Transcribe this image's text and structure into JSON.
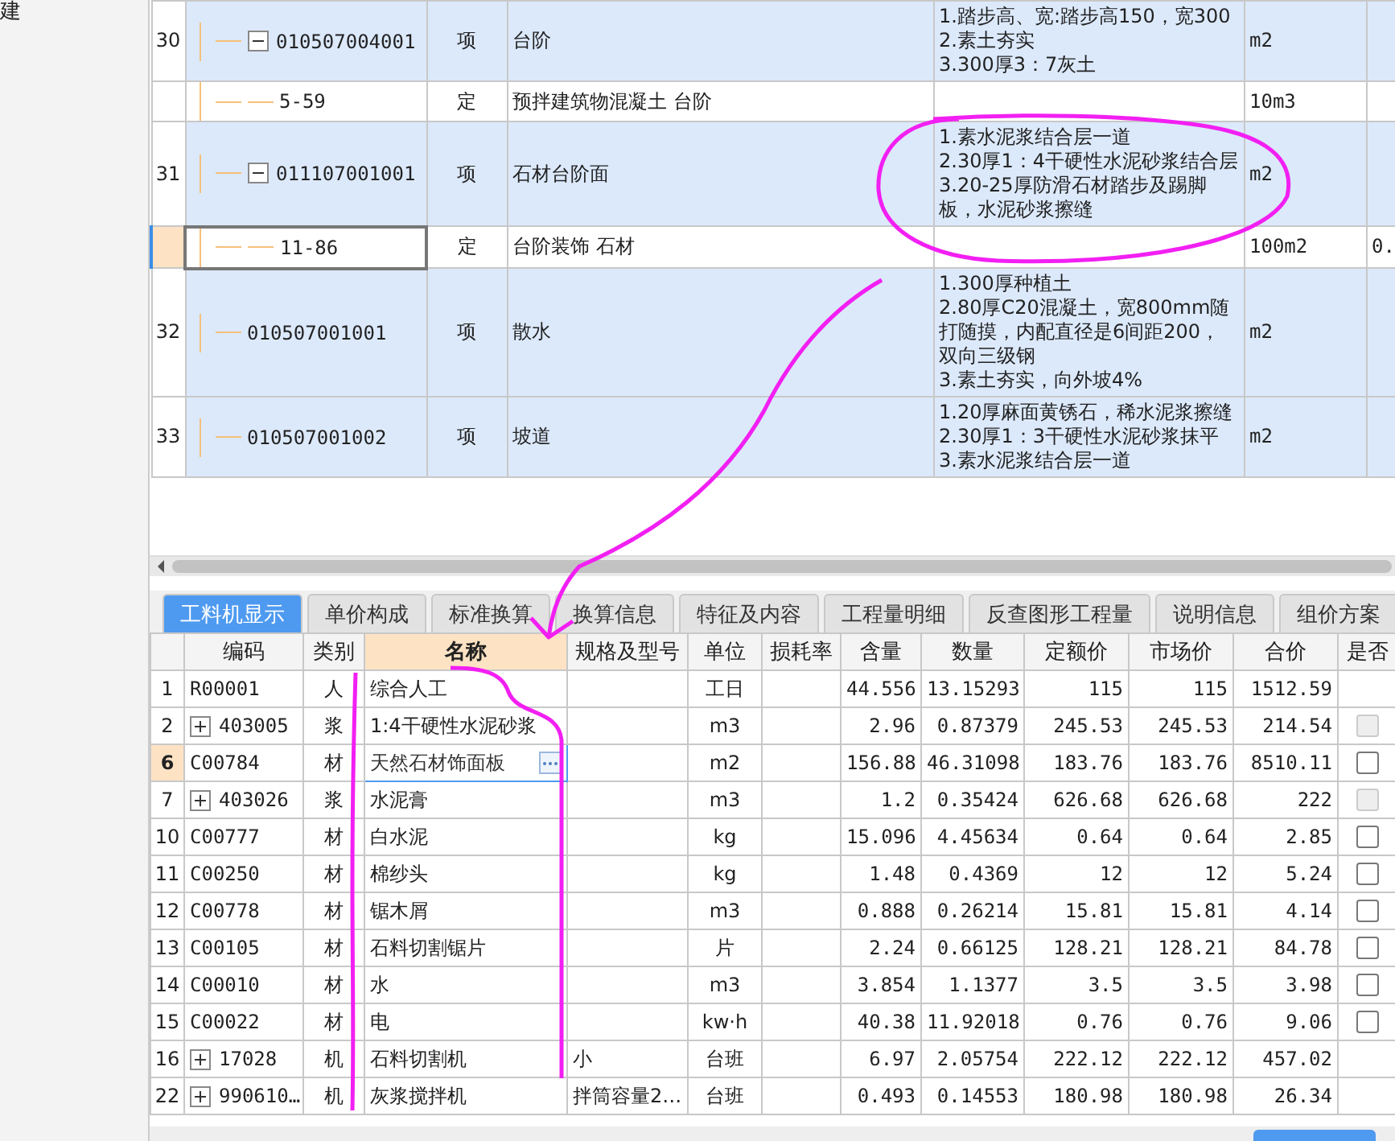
{
  "side_panel": {
    "title": "建"
  },
  "bill_rows": [
    {
      "num": "30",
      "code": "010507004001",
      "type": "项",
      "name": "台阶",
      "features": "1.踏步高、宽:踏步高150，宽300\n2.素土夯实\n3.300厚3：7灰土",
      "unit": "m2",
      "expanded": true,
      "selected": false,
      "children": [
        {
          "code": "5-59",
          "type": "定",
          "name": "预拌建筑物混凝土 台阶",
          "unit": "10m3",
          "selected": false
        }
      ]
    },
    {
      "num": "31",
      "code": "011107001001",
      "type": "项",
      "name": "石材台阶面",
      "features": "1.素水泥浆结合层一道\n2.30厚1：4干硬性水泥砂浆结合层\n3.20-25厚防滑石材踏步及踢脚板，水泥砂浆擦缝",
      "unit": "m2",
      "expanded": true,
      "selected": false,
      "children": [
        {
          "code": "11-86",
          "type": "定",
          "name": "台阶装饰 石材",
          "unit": "100m2",
          "column_7": "0.",
          "selected": true
        }
      ]
    },
    {
      "num": "32",
      "code": "010507001001",
      "type": "项",
      "name": "散水",
      "features": "1.300厚种植土\n2.80厚C20混凝土，宽800mm随打随摸，内配直径是6间距200，双向三级钢\n3.素土夯实，向外坡4%",
      "unit": "m2",
      "selected": false
    },
    {
      "num": "33",
      "code": "010507001002",
      "type": "项",
      "name": "坡道",
      "features": "1.20厚麻面黄锈石，稀水泥浆擦缝\n2.30厚1：3干硬性水泥砂浆抹平\n3.素水泥浆结合层一道",
      "unit": "m2",
      "selected": false
    }
  ],
  "tabs": [
    {
      "label": "工料机显示",
      "selected": true
    },
    {
      "label": "单价构成",
      "selected": false
    },
    {
      "label": "标准换算",
      "selected": false
    },
    {
      "label": "换算信息",
      "selected": false
    },
    {
      "label": "特征及内容",
      "selected": false
    },
    {
      "label": "工程量明细",
      "selected": false
    },
    {
      "label": "反查图形工程量",
      "selected": false
    },
    {
      "label": "说明信息",
      "selected": false
    },
    {
      "label": "组价方案",
      "selected": false
    }
  ],
  "columns": [
    {
      "label": "编码",
      "sorted": false
    },
    {
      "label": "类别",
      "sorted": false
    },
    {
      "label": "名称",
      "sorted": true
    },
    {
      "label": "规格及型号",
      "sorted": false
    },
    {
      "label": "单位",
      "sorted": false
    },
    {
      "label": "损耗率",
      "sorted": false
    },
    {
      "label": "含量",
      "sorted": false
    },
    {
      "label": "数量",
      "sorted": false
    },
    {
      "label": "定额价",
      "sorted": false
    },
    {
      "label": "市场价",
      "sorted": false
    },
    {
      "label": "合价",
      "sorted": false
    },
    {
      "label": "是否",
      "sorted": false
    }
  ],
  "resources": [
    {
      "num": "1",
      "expandable": false,
      "code": "R00001",
      "type": "人",
      "name": "综合人工",
      "unit": "工日",
      "content": "44.556",
      "qty": "13.15293",
      "quota_price": "115",
      "market_price": "115",
      "total": "1512.59",
      "selected": false
    },
    {
      "num": "2",
      "expandable": true,
      "code": "403005",
      "type": "浆",
      "name": "1:4干硬性水泥砂浆",
      "unit": "m3",
      "content": "2.96",
      "qty": "0.87379",
      "quota_price": "245.53",
      "market_price": "245.53",
      "total": "214.54",
      "selected": false,
      "checkbox": {
        "checked": false,
        "disabled": true
      }
    },
    {
      "num": "6",
      "expandable": false,
      "code": "C00784",
      "type": "材",
      "name": "天然石材饰面板",
      "unit": "m2",
      "content": "156.88",
      "qty": "46.31098",
      "quota_price": "183.76",
      "market_price": "183.76",
      "total": "8510.11",
      "selected": true,
      "checkbox": {
        "checked": false,
        "disabled": false
      }
    },
    {
      "num": "7",
      "expandable": true,
      "code": "403026",
      "type": "浆",
      "name": "水泥膏",
      "unit": "m3",
      "content": "1.2",
      "qty": "0.35424",
      "quota_price": "626.68",
      "market_price": "626.68",
      "total": "222",
      "selected": false,
      "checkbox": {
        "checked": false,
        "disabled": true
      }
    },
    {
      "num": "10",
      "expandable": false,
      "code": "C00777",
      "type": "材",
      "name": "白水泥",
      "unit": "kg",
      "content": "15.096",
      "qty": "4.45634",
      "quota_price": "0.64",
      "market_price": "0.64",
      "total": "2.85",
      "selected": false,
      "checkbox": {
        "checked": false,
        "disabled": false
      }
    },
    {
      "num": "11",
      "expandable": false,
      "code": "C00250",
      "type": "材",
      "name": "棉纱头",
      "unit": "kg",
      "content": "1.48",
      "qty": "0.4369",
      "quota_price": "12",
      "market_price": "12",
      "total": "5.24",
      "selected": false,
      "checkbox": {
        "checked": false,
        "disabled": false
      }
    },
    {
      "num": "12",
      "expandable": false,
      "code": "C00778",
      "type": "材",
      "name": "锯木屑",
      "unit": "m3",
      "content": "0.888",
      "qty": "0.26214",
      "quota_price": "15.81",
      "market_price": "15.81",
      "total": "4.14",
      "selected": false,
      "checkbox": {
        "checked": false,
        "disabled": false
      }
    },
    {
      "num": "13",
      "expandable": false,
      "code": "C00105",
      "type": "材",
      "name": "石料切割锯片",
      "unit": "片",
      "content": "2.24",
      "qty": "0.66125",
      "quota_price": "128.21",
      "market_price": "128.21",
      "total": "84.78",
      "selected": false,
      "checkbox": {
        "checked": false,
        "disabled": false
      }
    },
    {
      "num": "14",
      "expandable": false,
      "code": "C00010",
      "type": "材",
      "name": "水",
      "unit": "m3",
      "content": "3.854",
      "qty": "1.1377",
      "quota_price": "3.5",
      "market_price": "3.5",
      "total": "3.98",
      "selected": false,
      "checkbox": {
        "checked": false,
        "disabled": false
      }
    },
    {
      "num": "15",
      "expandable": false,
      "code": "C00022",
      "type": "材",
      "name": "电",
      "unit": "kw·h",
      "content": "40.38",
      "qty": "11.92018",
      "quota_price": "0.76",
      "market_price": "0.76",
      "total": "9.06",
      "selected": false,
      "checkbox": {
        "checked": false,
        "disabled": false
      }
    },
    {
      "num": "16",
      "expandable": true,
      "code": "17028",
      "type": "机",
      "name": "石料切割机",
      "spec": "小",
      "unit": "台班",
      "content": "6.97",
      "qty": "2.05754",
      "quota_price": "222.12",
      "market_price": "222.12",
      "total": "457.02",
      "selected": false
    },
    {
      "num": "22",
      "expandable": true,
      "code": "990610…",
      "type": "机",
      "name": "灰浆搅拌机",
      "spec": "拌筒容量2…",
      "unit": "台班",
      "content": "0.493",
      "qty": "0.14553",
      "quota_price": "180.98",
      "market_price": "180.98",
      "total": "26.34",
      "selected": false
    }
  ]
}
